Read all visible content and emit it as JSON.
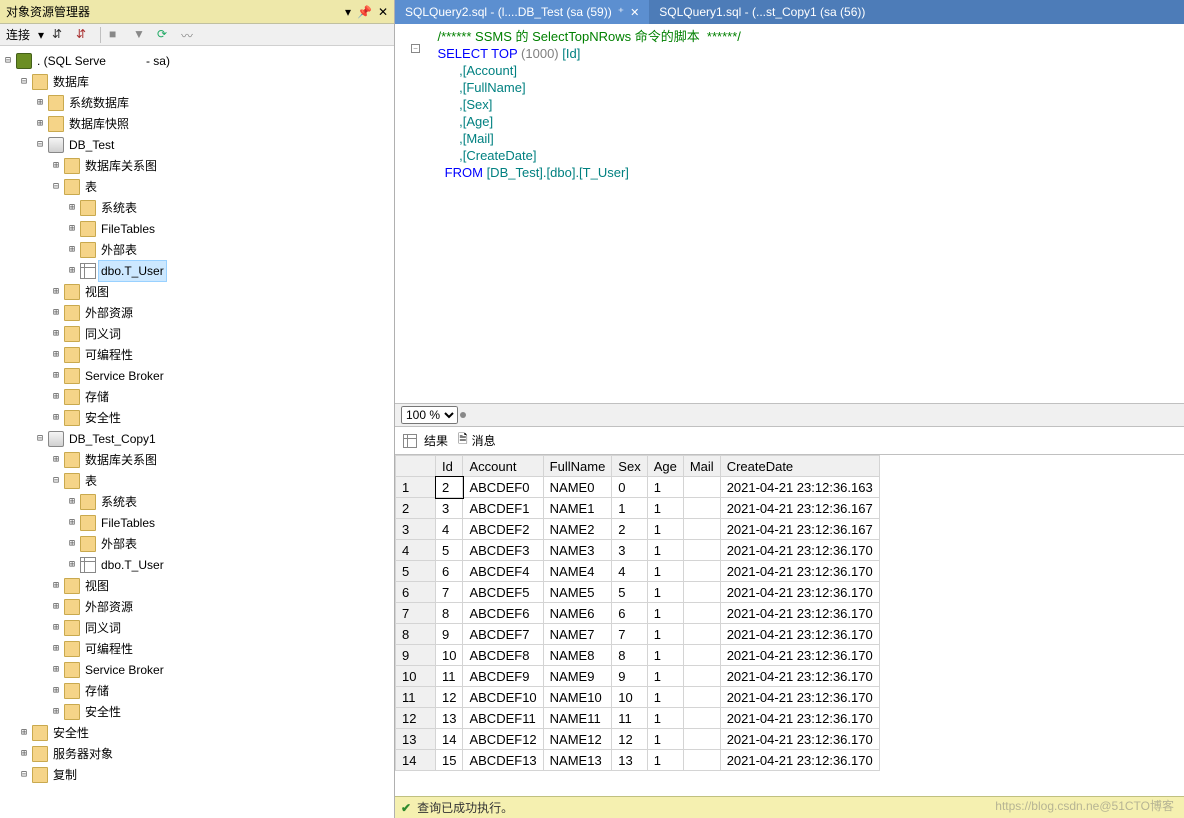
{
  "left": {
    "title": "对象资源管理器",
    "connect_label": "连接",
    "server": ". (SQL Serve",
    "server_suffix": "- sa)",
    "db_label": "数据库",
    "sysdb": "系统数据库",
    "snapshot": "数据库快照",
    "db1": "DB_Test",
    "db2": "DB_Test_Copy1",
    "diagram": "数据库关系图",
    "tables": "表",
    "sys_tables": "系统表",
    "file_tables": "FileTables",
    "external_tables": "外部表",
    "tuser": "dbo.T_User",
    "views": "视图",
    "ext_res": "外部资源",
    "synonyms": "同义词",
    "programmability": "可编程性",
    "service_broker": "Service Broker",
    "storage": "存储",
    "security": "安全性",
    "sec_root": "安全性",
    "server_objects": "服务器对象",
    "replication": "复制"
  },
  "tabs": {
    "t1": "SQLQuery2.sql - (l....DB_Test (sa (59))",
    "t2": "SQLQuery1.sql - (...st_Copy1 (sa (56))"
  },
  "sql": {
    "l1": "/****** SSMS 的 SelectTopNRows 命令的脚本  ******/",
    "l2a": "SELECT",
    "l2b": " TOP ",
    "l2c": "(1000) ",
    "l2d": "[Id]",
    "l3": "      ,[Account]",
    "l4": "      ,[FullName]",
    "l5": "      ,[Sex]",
    "l6": "      ,[Age]",
    "l7": "      ,[Mail]",
    "l8": "      ,[CreateDate]",
    "l9a": "  FROM ",
    "l9b": "[DB_Test].[dbo].[T_User]"
  },
  "zoom": "100 %",
  "result_tabs": {
    "results": "结果",
    "messages": "消息"
  },
  "grid": {
    "headers": [
      "",
      "Id",
      "Account",
      "FullName",
      "Sex",
      "Age",
      "Mail",
      "CreateDate"
    ],
    "rows": [
      [
        "1",
        "2",
        "ABCDEF0",
        "NAME0",
        "0",
        "1",
        "",
        "2021-04-21 23:12:36.163"
      ],
      [
        "2",
        "3",
        "ABCDEF1",
        "NAME1",
        "1",
        "1",
        "",
        "2021-04-21 23:12:36.167"
      ],
      [
        "3",
        "4",
        "ABCDEF2",
        "NAME2",
        "2",
        "1",
        "",
        "2021-04-21 23:12:36.167"
      ],
      [
        "4",
        "5",
        "ABCDEF3",
        "NAME3",
        "3",
        "1",
        "",
        "2021-04-21 23:12:36.170"
      ],
      [
        "5",
        "6",
        "ABCDEF4",
        "NAME4",
        "4",
        "1",
        "",
        "2021-04-21 23:12:36.170"
      ],
      [
        "6",
        "7",
        "ABCDEF5",
        "NAME5",
        "5",
        "1",
        "",
        "2021-04-21 23:12:36.170"
      ],
      [
        "7",
        "8",
        "ABCDEF6",
        "NAME6",
        "6",
        "1",
        "",
        "2021-04-21 23:12:36.170"
      ],
      [
        "8",
        "9",
        "ABCDEF7",
        "NAME7",
        "7",
        "1",
        "",
        "2021-04-21 23:12:36.170"
      ],
      [
        "9",
        "10",
        "ABCDEF8",
        "NAME8",
        "8",
        "1",
        "",
        "2021-04-21 23:12:36.170"
      ],
      [
        "10",
        "11",
        "ABCDEF9",
        "NAME9",
        "9",
        "1",
        "",
        "2021-04-21 23:12:36.170"
      ],
      [
        "11",
        "12",
        "ABCDEF10",
        "NAME10",
        "10",
        "1",
        "",
        "2021-04-21 23:12:36.170"
      ],
      [
        "12",
        "13",
        "ABCDEF11",
        "NAME11",
        "11",
        "1",
        "",
        "2021-04-21 23:12:36.170"
      ],
      [
        "13",
        "14",
        "ABCDEF12",
        "NAME12",
        "12",
        "1",
        "",
        "2021-04-21 23:12:36.170"
      ],
      [
        "14",
        "15",
        "ABCDEF13",
        "NAME13",
        "13",
        "1",
        "",
        "2021-04-21 23:12:36.170"
      ]
    ]
  },
  "status": "查询已成功执行。",
  "watermark": "https://blog.csdn.ne@51CTO博客"
}
